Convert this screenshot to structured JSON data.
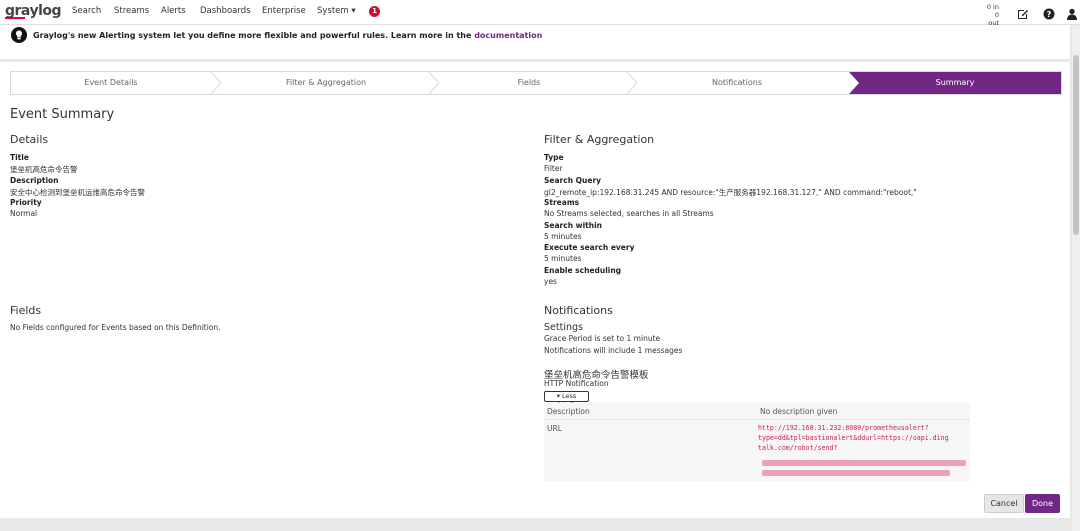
{
  "brand": {
    "name": "graylog",
    "accent": "#702785",
    "logo_red": "#e3003c"
  },
  "nav": {
    "items": [
      "Search",
      "Streams",
      "Alerts",
      "Dashboards",
      "Enterprise",
      "System ▾"
    ],
    "notification_count": "1",
    "throughput_in": "0 in",
    "throughput_out": "0 out",
    "icons": [
      "edit-icon",
      "help-icon",
      "user-icon"
    ]
  },
  "notice": {
    "text": "Graylog's new Alerting system let you define more flexible and powerful rules. Learn more in the",
    "link": "documentation"
  },
  "wizard": {
    "steps": [
      "Event Details",
      "Filter & Aggregation",
      "Fields",
      "Notifications",
      "Summary"
    ],
    "active": "Summary"
  },
  "summary": {
    "title": "Event Summary",
    "details": {
      "heading": "Details",
      "title_label": "Title",
      "title_value": "堡垒机高危命令告警",
      "description_label": "Description",
      "description_value": "安全中心检测到堡垒机运维高危命令告警",
      "priority_label": "Priority",
      "priority_value": "Normal"
    },
    "fields": {
      "heading": "Fields",
      "text": "No Fields configured for Events based on this Definition."
    },
    "filter": {
      "heading": "Filter & Aggregation",
      "type_label": "Type",
      "type_value": "Filter",
      "query_label": "Search Query",
      "query_value": "gl2_remote_ip:192.168.31.245 AND resource:\"生产服务器192.168.31.127,\" AND command:\"reboot,\"",
      "streams_label": "Streams",
      "streams_value": "No Streams selected, searches in all Streams",
      "within_label": "Search within",
      "within_value": "5 minutes",
      "every_label": "Execute search every",
      "every_value": "5 minutes",
      "scheduling_label": "Enable scheduling",
      "scheduling_value": "yes"
    },
    "notifications": {
      "heading": "Notifications",
      "settings_heading": "Settings",
      "grace": "Grace Period is set to 1 minute",
      "include": "Notifications will include 1 messages",
      "notification_title": "堡垒机高危命令告警模板",
      "notification_type": "HTTP Notification",
      "less_details": "▾ Less details",
      "table": {
        "description_label": "Description",
        "description_value": "No description given",
        "url_label": "URL",
        "url_lines": [
          "http://192.168.31.232:8080/prometheusalert?",
          "type=dd&tpl=bastionalert&ddurl=https://oapi.ding",
          "talk.com/robot/send?"
        ]
      }
    }
  },
  "buttons": {
    "cancel": "Cancel",
    "done": "Done"
  }
}
